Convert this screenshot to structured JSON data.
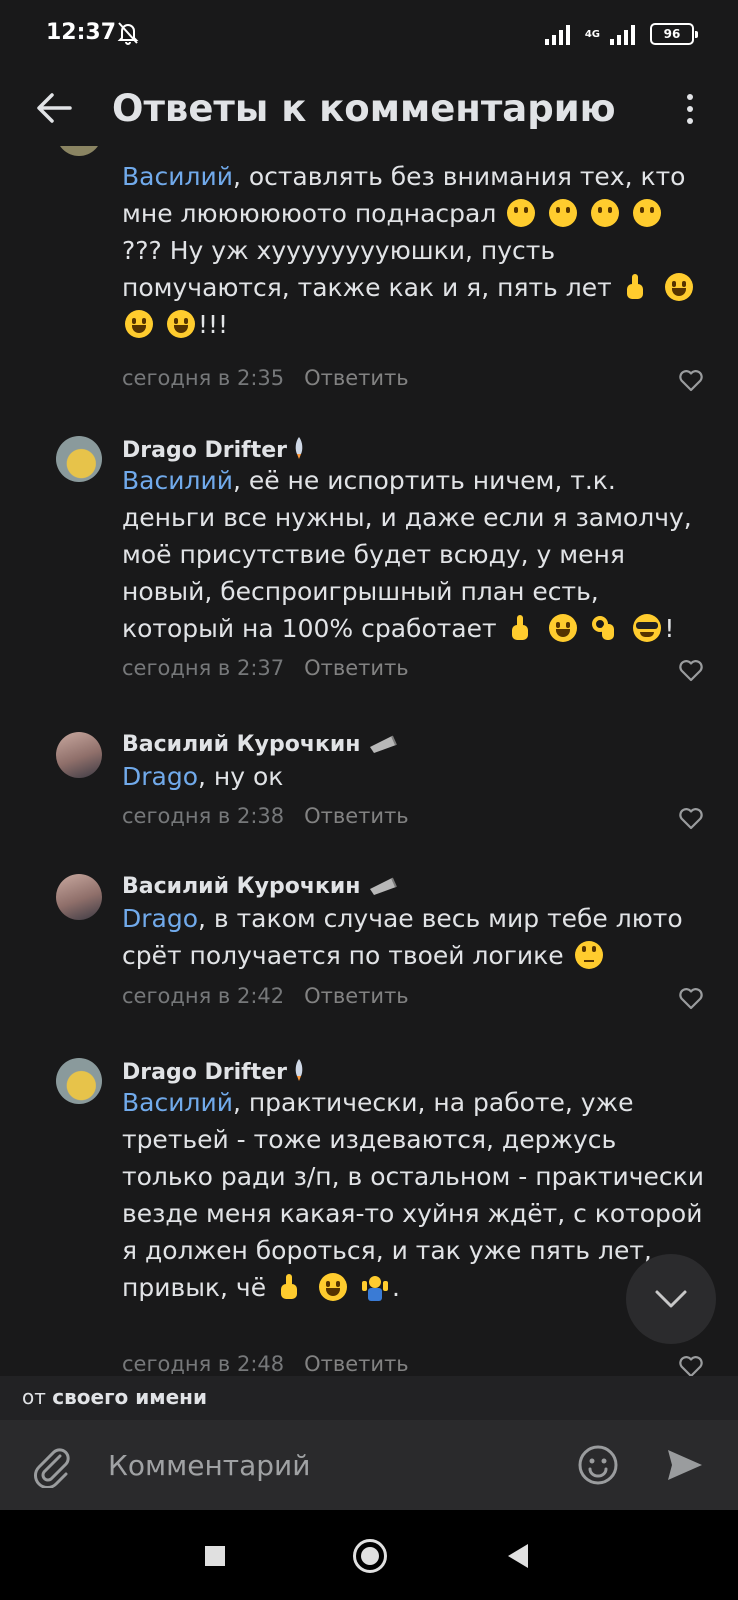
{
  "status_bar": {
    "time": "12:37",
    "battery": "96",
    "network": "4G"
  },
  "header": {
    "title": "Ответы к комментарию"
  },
  "comments": [
    {
      "mention": "Василий",
      "text": ", оставлять без внимания тех, кто мне люююююото поднасрал",
      "text2": " ??? Ну уж хууууууууюшки, пусть помучаются, также как и я, пять лет",
      "text3": "!!!",
      "time": "сегодня в 2:35",
      "reply": "Ответить"
    },
    {
      "author": "Drago Drifter",
      "mention": "Василий",
      "text": ", её не испортить ничем, т.к. деньги все нужны, и даже если я замолчу, моё присутствие будет всюду, у меня новый, беспроигрышный план есть, который на 100% сработает",
      "text_end": "!",
      "time": "сегодня в 2:37",
      "reply": "Ответить"
    },
    {
      "author": "Василий Курочкин",
      "mention": "Drago",
      "text": ", ну ок",
      "time": "сегодня в 2:38",
      "reply": "Ответить"
    },
    {
      "author": "Василий Курочкин",
      "mention": "Drago",
      "text": ", в таком случае весь мир тебе люто срёт получается по твоей логике",
      "time": "сегодня в 2:42",
      "reply": "Ответить"
    },
    {
      "author": "Drago Drifter",
      "mention": "Василий",
      "text": ", практически, на работе, уже третьей - тоже издеваются, держусь только ради з/п, в остальном - практически везде меня какая-то хуйня ждёт, с которой я должен бороться, и так уже пять лет, привык, чё",
      "text_end": ".",
      "time": "сегодня в 2:48",
      "reply": "Ответить"
    }
  ],
  "sender": {
    "prefix": "от",
    "name": "своего имени"
  },
  "input": {
    "placeholder": "Комментарий"
  },
  "colors": {
    "background": "#19191a",
    "mention": "#71aaeb",
    "meta": "#76787a",
    "input_bar": "#2a2a2c"
  }
}
